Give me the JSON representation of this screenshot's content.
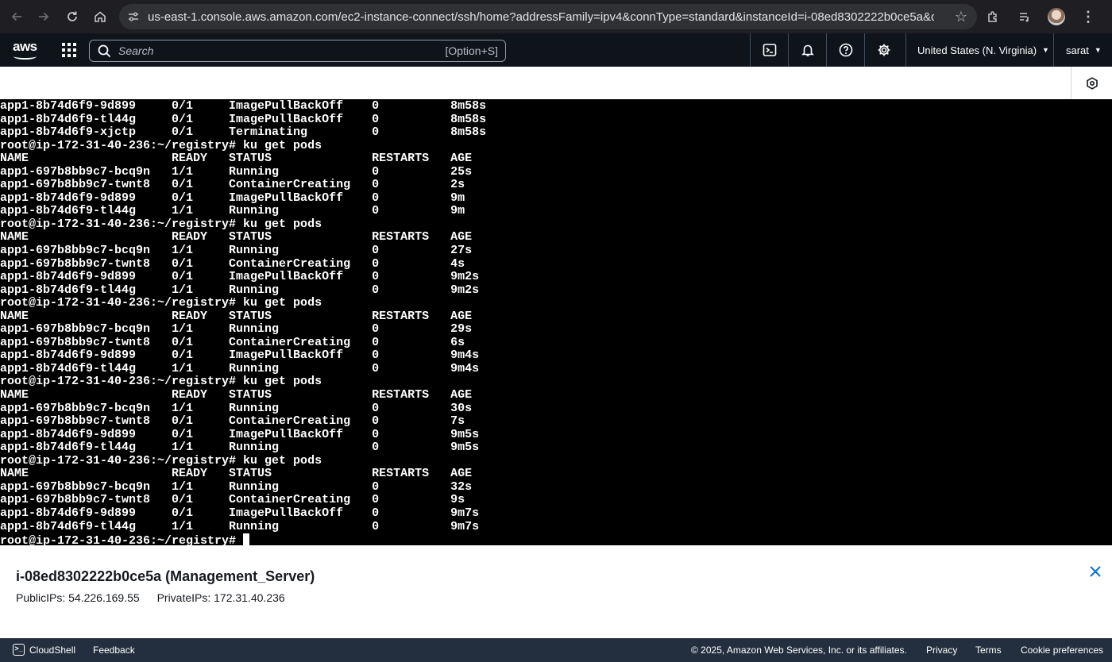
{
  "browser": {
    "url": "us-east-1.console.aws.amazon.com/ec2-instance-connect/ssh/home?addressFamily=ipv4&connType=standard&instanceId=i-08ed8302222b0ce5a&osU..."
  },
  "aws_header": {
    "search_placeholder": "Search",
    "search_shortcut": "[Option+S]",
    "region": "United States (N. Virginia)",
    "user": "sarat"
  },
  "terminal": {
    "lines": [
      "app1-8b74d6f9-9d899     0/1     ImagePullBackOff    0          8m58s",
      "app1-8b74d6f9-tl44g     0/1     ImagePullBackOff    0          8m58s",
      "app1-8b74d6f9-xjctp     0/1     Terminating         0          8m58s",
      "root@ip-172-31-40-236:~/registry# ku get pods",
      "NAME                    READY   STATUS              RESTARTS   AGE",
      "app1-697b8bb9c7-bcq9n   1/1     Running             0          25s",
      "app1-697b8bb9c7-twnt8   0/1     ContainerCreating   0          2s",
      "app1-8b74d6f9-9d899     0/1     ImagePullBackOff    0          9m",
      "app1-8b74d6f9-tl44g     1/1     Running             0          9m",
      "root@ip-172-31-40-236:~/registry# ku get pods",
      "NAME                    READY   STATUS              RESTARTS   AGE",
      "app1-697b8bb9c7-bcq9n   1/1     Running             0          27s",
      "app1-697b8bb9c7-twnt8   0/1     ContainerCreating   0          4s",
      "app1-8b74d6f9-9d899     0/1     ImagePullBackOff    0          9m2s",
      "app1-8b74d6f9-tl44g     1/1     Running             0          9m2s",
      "root@ip-172-31-40-236:~/registry# ku get pods",
      "NAME                    READY   STATUS              RESTARTS   AGE",
      "app1-697b8bb9c7-bcq9n   1/1     Running             0          29s",
      "app1-697b8bb9c7-twnt8   0/1     ContainerCreating   0          6s",
      "app1-8b74d6f9-9d899     0/1     ImagePullBackOff    0          9m4s",
      "app1-8b74d6f9-tl44g     1/1     Running             0          9m4s",
      "root@ip-172-31-40-236:~/registry# ku get pods",
      "NAME                    READY   STATUS              RESTARTS   AGE",
      "app1-697b8bb9c7-bcq9n   1/1     Running             0          30s",
      "app1-697b8bb9c7-twnt8   0/1     ContainerCreating   0          7s",
      "app1-8b74d6f9-9d899     0/1     ImagePullBackOff    0          9m5s",
      "app1-8b74d6f9-tl44g     1/1     Running             0          9m5s",
      "root@ip-172-31-40-236:~/registry# ku get pods",
      "NAME                    READY   STATUS              RESTARTS   AGE",
      "app1-697b8bb9c7-bcq9n   1/1     Running             0          32s",
      "app1-697b8bb9c7-twnt8   0/1     ContainerCreating   0          9s",
      "app1-8b74d6f9-9d899     0/1     ImagePullBackOff    0          9m7s",
      "app1-8b74d6f9-tl44g     1/1     Running             0          9m7s"
    ],
    "prompt": "root@ip-172-31-40-236:~/registry# "
  },
  "instance": {
    "title": "i-08ed8302222b0ce5a (Management_Server)",
    "public_ips": "PublicIPs: 54.226.169.55",
    "private_ips": "PrivateIPs: 172.31.40.236"
  },
  "footer": {
    "cloudshell": "CloudShell",
    "feedback": "Feedback",
    "copyright": "© 2025, Amazon Web Services, Inc. or its affiliates.",
    "privacy": "Privacy",
    "terms": "Terms",
    "cookies": "Cookie preferences"
  }
}
